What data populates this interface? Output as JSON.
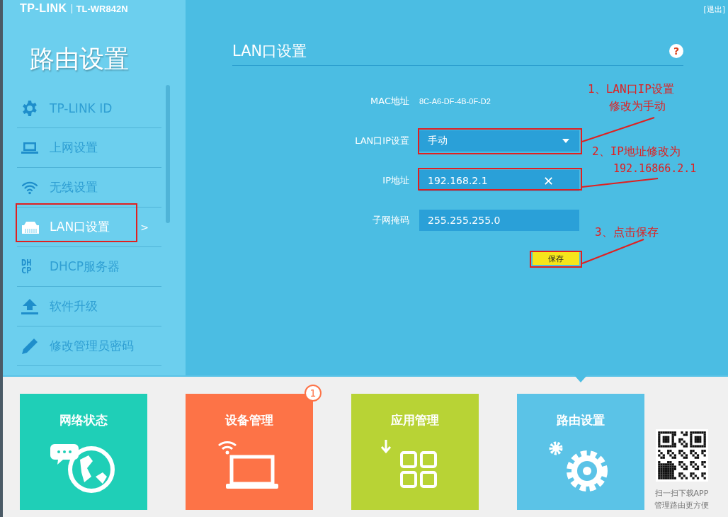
{
  "header": {
    "brand": "TP-LINK",
    "model": "TL-WR842N",
    "logout": "[退出]"
  },
  "sidebar": {
    "title": "路由设置",
    "items": [
      {
        "label": "TP-LINK ID",
        "kind": "gear",
        "selected": false
      },
      {
        "label": "上网设置",
        "kind": "laptop",
        "selected": false
      },
      {
        "label": "无线设置",
        "kind": "wifi",
        "selected": false
      },
      {
        "label": "LAN口设置",
        "kind": "ethernet",
        "selected": true,
        "arrow": ">"
      },
      {
        "label": "DHCP服务器",
        "kind": "dhcp",
        "icon_text": "DHCP",
        "selected": false
      },
      {
        "label": "软件升级",
        "kind": "upload",
        "selected": false
      },
      {
        "label": "修改管理员密码",
        "kind": "pencil",
        "selected": false
      }
    ]
  },
  "panel": {
    "title": "LAN口设置",
    "help": "?",
    "fields": [
      {
        "kind": "text",
        "label": "MAC地址",
        "value": "8C-A6-DF-4B-0F-D2"
      },
      {
        "kind": "select",
        "label": "LAN口IP设置",
        "value": "手动"
      },
      {
        "kind": "input",
        "label": "IP地址",
        "value": "192.168.2.1",
        "clear": "✕"
      },
      {
        "kind": "input",
        "label": "子网掩码",
        "value": "255.255.255.0"
      }
    ],
    "save_button": "保存"
  },
  "annotations": [
    {
      "lines": [
        "1、LAN口IP设置",
        "修改为手动"
      ]
    },
    {
      "lines": [
        "2、IP地址修改为",
        "192.16866.2.1"
      ]
    },
    {
      "lines": [
        "3、点击保存"
      ]
    }
  ],
  "tiles": [
    {
      "label": "网络状态",
      "kind": "globe",
      "color": "#1fcfb7",
      "selected": false
    },
    {
      "label": "设备管理",
      "kind": "laptop",
      "color": "#fd7347",
      "selected": false,
      "badge": "1"
    },
    {
      "label": "应用管理",
      "kind": "apps",
      "color": "#b8d335",
      "selected": false
    },
    {
      "label": "路由设置",
      "kind": "gears",
      "color": "#5bc3e7",
      "selected": true
    }
  ],
  "qr": {
    "caption_lines": [
      "扫一扫下载APP",
      "管理路由更方便"
    ]
  }
}
